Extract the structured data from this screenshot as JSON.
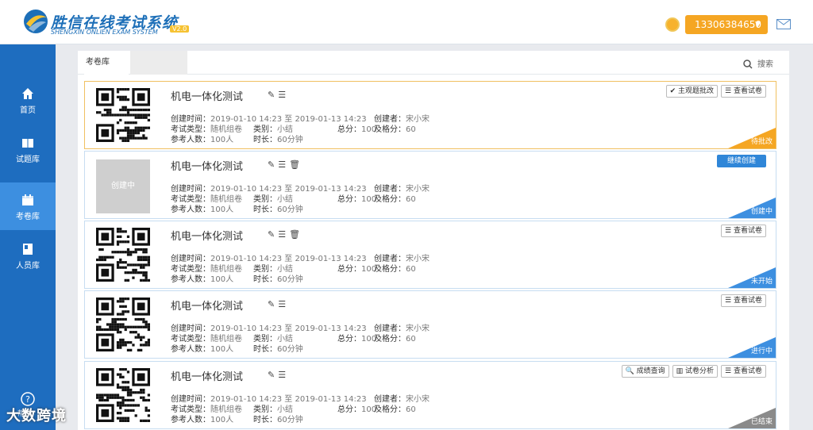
{
  "app": {
    "title": "胜信在线考试系统",
    "subtitle": "SHENGXIN ONLIEN EXAM SYSTEM",
    "version": "V2.0"
  },
  "header": {
    "user": "13306384650"
  },
  "sidebar": {
    "items": [
      {
        "label": "首页",
        "icon": "home-icon"
      },
      {
        "label": "试题库",
        "icon": "book-icon"
      },
      {
        "label": "考卷库",
        "icon": "calendar-icon"
      },
      {
        "label": "人员库",
        "icon": "address-book-icon"
      }
    ],
    "help_label": "帮助"
  },
  "tabs": {
    "active": "考卷库"
  },
  "search": {
    "label": "搜索"
  },
  "labels": {
    "created_time": "创建时间：",
    "exam_type": "考试类型：",
    "count": "参考人数：",
    "category": "类别：",
    "duration": "时长：",
    "creator": "创建者：",
    "total": "总分：",
    "pass": "及格分："
  },
  "cards": [
    {
      "title": "机电一体化测试",
      "time": "2019-01-10 14:23 至 2019-01-13 14:23",
      "type": "随机组卷",
      "count": "100人",
      "category": "小结",
      "duration": "60分钟",
      "creator": "宋小宋",
      "total": "100",
      "pass": "60",
      "status": "待批改",
      "buttons": [
        "主观题批改",
        "查看试卷"
      ]
    },
    {
      "title": "机电一体化测试",
      "time": "2019-01-10 14:23 至 2019-01-13 14:23",
      "type": "随机组卷",
      "count": "100人",
      "category": "小结",
      "duration": "60分钟",
      "creator": "宋小宋",
      "total": "100",
      "pass": "60",
      "status": "创建中",
      "placeholder": "创建中",
      "buttons": [
        "继续创建"
      ]
    },
    {
      "title": "机电一体化测试",
      "time": "2019-01-10 14:23 至 2019-01-13 14:23",
      "type": "随机组卷",
      "count": "100人",
      "category": "小结",
      "duration": "60分钟",
      "creator": "宋小宋",
      "total": "100",
      "pass": "60",
      "status": "未开始",
      "buttons": [
        "查看试卷"
      ]
    },
    {
      "title": "机电一体化测试",
      "time": "2019-01-10 14:23 至 2019-01-13 14:23",
      "type": "随机组卷",
      "count": "100人",
      "category": "小结",
      "duration": "60分钟",
      "creator": "宋小宋",
      "total": "100",
      "pass": "60",
      "status": "进行中",
      "buttons": [
        "查看试卷"
      ]
    },
    {
      "title": "机电一体化测试",
      "time": "2019-01-10 14:23 至 2019-01-13 14:23",
      "type": "随机组卷",
      "count": "100人",
      "category": "小结",
      "duration": "60分钟",
      "creator": "宋小宋",
      "total": "100",
      "pass": "60",
      "status": "已结束",
      "buttons": [
        "成绩查询",
        "试卷分析",
        "查看试卷"
      ]
    }
  ],
  "watermark": "大数跨境",
  "colors": {
    "primary": "#1e6dbf",
    "active": "#3d8fe0",
    "accent": "#f5a623",
    "pending": "#f5a623",
    "draft": "#3d8fe0",
    "upcoming": "#3d8fe0",
    "ongoing": "#3d8fe0",
    "ended": "#8a8a8a"
  }
}
